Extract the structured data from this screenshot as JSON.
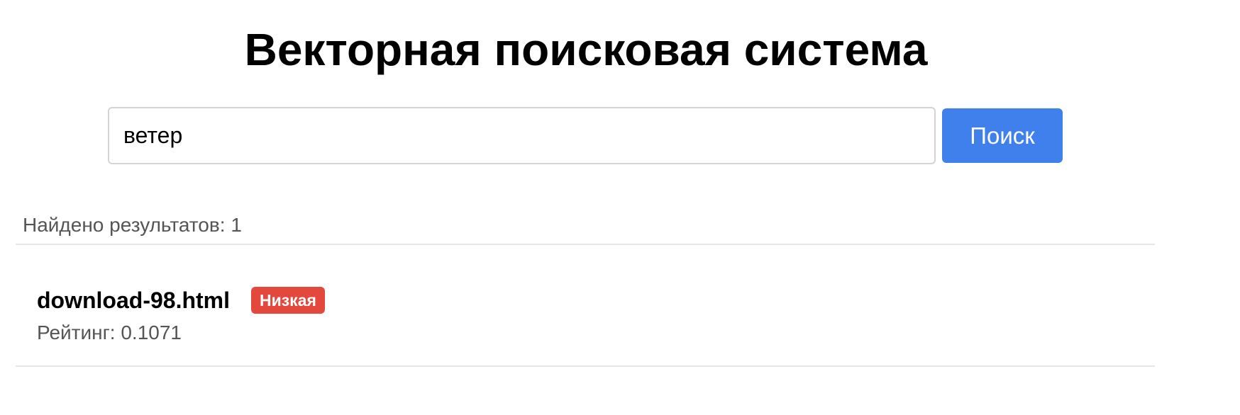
{
  "page": {
    "title": "Векторная поисковая система"
  },
  "search": {
    "value": "ветер",
    "button_label": "Поиск"
  },
  "results": {
    "count_label": "Найдено результатов: 1",
    "items": [
      {
        "title": "download-98.html",
        "badge": "Низкая",
        "score_label": "Рейтинг: 0.1071"
      }
    ]
  },
  "colors": {
    "button": "#4080ed",
    "badge_low": "#e4483c",
    "muted_text": "#555555",
    "divider": "#e6e6e6"
  }
}
